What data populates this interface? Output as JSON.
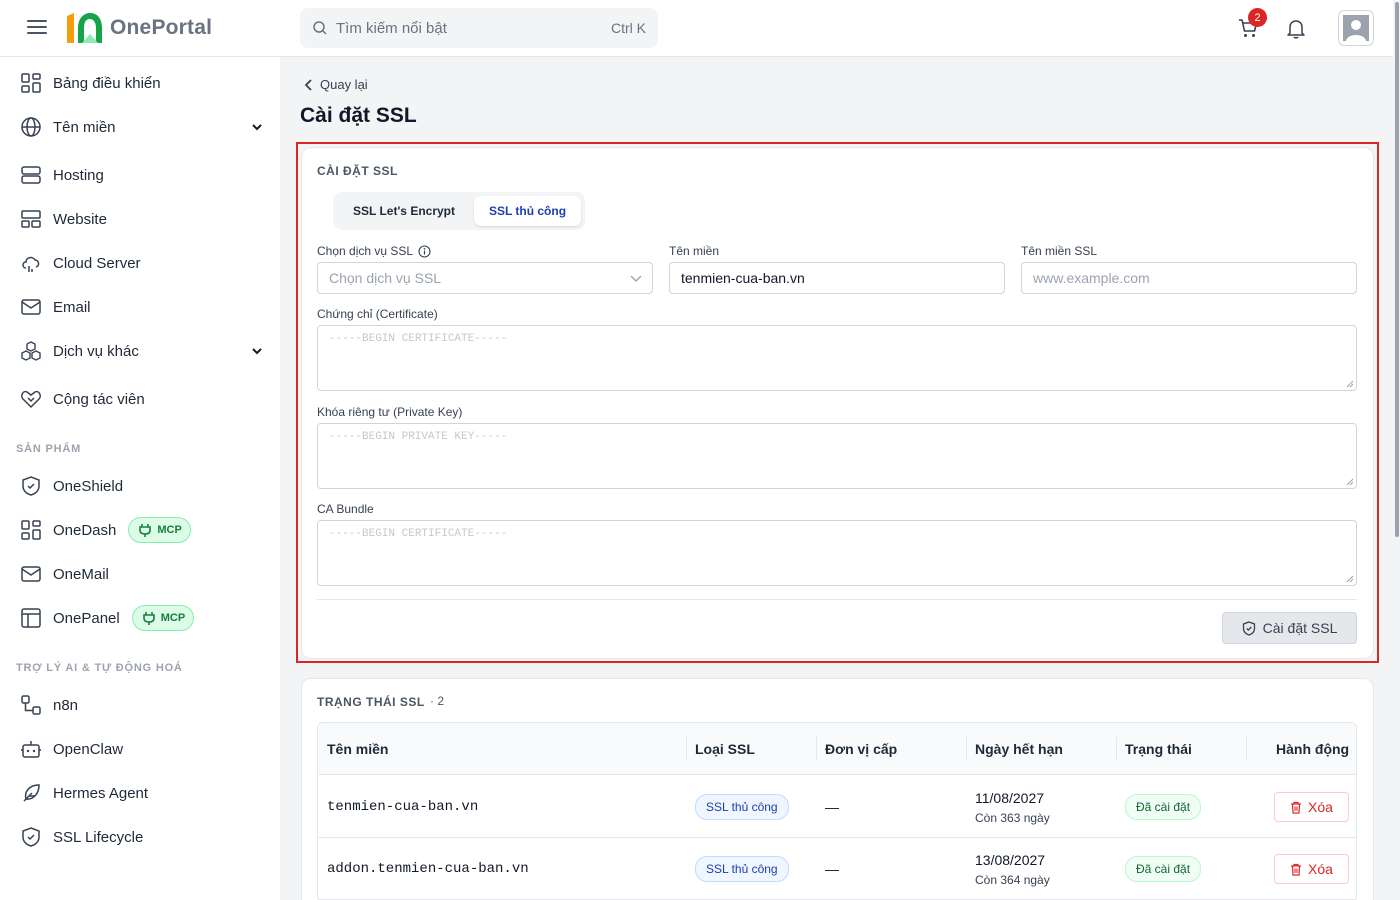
{
  "header": {
    "brand": "OnePortal",
    "search_placeholder": "Tìm kiếm nổi bật",
    "search_shortcut": "Ctrl K",
    "cart_count": "2"
  },
  "sidebar": {
    "items": [
      {
        "label": "Bảng điều khiển",
        "icon": "dashboard-icon"
      },
      {
        "label": "Tên miền",
        "icon": "globe-icon",
        "expandable": true
      },
      {
        "label": "Hosting",
        "icon": "server-icon"
      },
      {
        "label": "Website",
        "icon": "layout-icon"
      },
      {
        "label": "Cloud Server",
        "icon": "cloud-icon"
      },
      {
        "label": "Email",
        "icon": "mail-icon"
      },
      {
        "label": "Dịch vụ khác",
        "icon": "boxes-icon",
        "expandable": true
      },
      {
        "label": "Cộng tác viên",
        "icon": "handshake-heart-icon"
      }
    ],
    "products_title": "SẢN PHẨM",
    "products": [
      {
        "label": "OneShield",
        "icon": "shield-icon"
      },
      {
        "label": "OneDash",
        "icon": "dashboard-icon",
        "badge": "MCP"
      },
      {
        "label": "OneMail",
        "icon": "mail-icon"
      },
      {
        "label": "OnePanel",
        "icon": "panel-icon",
        "badge": "MCP"
      }
    ],
    "ai_title": "TRỢ LÝ AI & TỰ ĐỘNG HOÁ",
    "ai_items": [
      {
        "label": "n8n",
        "icon": "workflow-icon"
      },
      {
        "label": "OpenClaw",
        "icon": "bot-icon"
      },
      {
        "label": "Hermes Agent",
        "icon": "feather-icon"
      },
      {
        "label": "SSL Lifecycle",
        "icon": "shield-check-icon"
      }
    ]
  },
  "main": {
    "back_label": "Quay lại",
    "page_title": "Cài đặt SSL"
  },
  "install_card": {
    "title": "CÀI ĐẶT SSL",
    "tabs": [
      "SSL Let's Encrypt",
      "SSL thủ công"
    ],
    "active_tab": "SSL thủ công",
    "service_label": "Chọn dịch vụ SSL",
    "service_placeholder": "Chọn dịch vụ SSL",
    "domain_label": "Tên miền",
    "domain_value": "tenmien-cua-ban.vn",
    "ssl_domain_label": "Tên miền SSL",
    "ssl_domain_placeholder": "www.example.com",
    "cert_label": "Chứng chỉ (Certificate)",
    "cert_placeholder": "-----BEGIN CERTIFICATE-----",
    "key_label": "Khóa riêng tư (Private Key)",
    "key_placeholder": "-----BEGIN PRIVATE KEY-----",
    "ca_label": "CA Bundle",
    "ca_placeholder": "-----BEGIN CERTIFICATE-----",
    "submit_label": "Cài đặt SSL"
  },
  "status_card": {
    "title": "TRẠNG THÁI SSL",
    "count": "· 2",
    "columns": [
      "Tên miền",
      "Loại SSL",
      "Đơn vị cấp",
      "Ngày hết hạn",
      "Trạng thái",
      "Hành động"
    ],
    "rows": [
      {
        "domain": "tenmien-cua-ban.vn",
        "type": "SSL thủ công",
        "issuer": "—",
        "expiry": "11/08/2027",
        "remaining": "Còn 363 ngày",
        "status": "Đã cài đặt",
        "action": "Xóa"
      },
      {
        "domain": "addon.tenmien-cua-ban.vn",
        "type": "SSL thủ công",
        "issuer": "—",
        "expiry": "13/08/2027",
        "remaining": "Còn 364 ngày",
        "status": "Đã cài đặt",
        "action": "Xóa"
      }
    ]
  },
  "colors": {
    "accent": "#1e40af",
    "danger": "#dc2626",
    "success": "#166534",
    "brand_green": "#16a34a",
    "brand_orange": "#f59e0b"
  }
}
